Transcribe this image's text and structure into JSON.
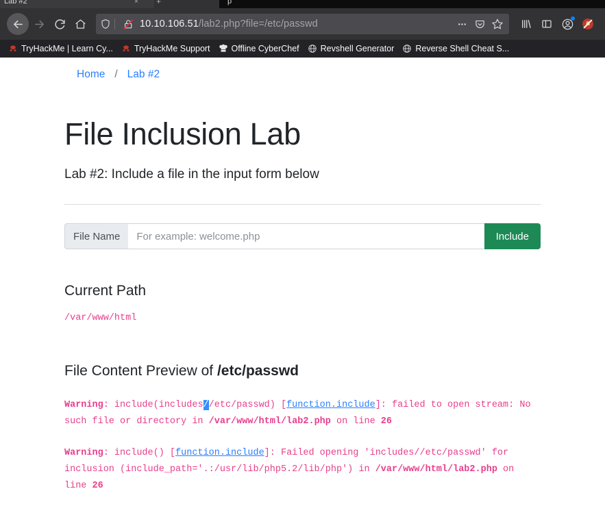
{
  "browser": {
    "tab": {
      "title": "Lab #2",
      "close_label": "×",
      "new_tab_label": "+",
      "spill_title": "p"
    },
    "nav": {
      "back_icon": "back-arrow-icon",
      "forward_icon": "forward-arrow-icon",
      "reload_icon": "reload-icon",
      "home_icon": "home-icon"
    },
    "urlbar": {
      "shield_icon": "tracking-protection-shield-icon",
      "insecure_icon": "insecure-crossed-padlock-icon",
      "url_host": "10.10.106.51",
      "url_path": "/lab2.php?file=/etc/passwd",
      "page_actions_icon": "ellipsis-icon",
      "pocket_icon": "pocket-icon",
      "bookmark_star_icon": "star-icon"
    },
    "toolbar_end": {
      "library_icon": "library-icon",
      "sidebar_icon": "sidebar-icon",
      "account_icon": "account-avatar-icon",
      "extension_icon": "blocked-extension-icon"
    },
    "bookmarks": [
      {
        "label": "TryHackMe | Learn Cy...",
        "icon": "tryhackme-favicon"
      },
      {
        "label": "TryHackMe Support",
        "icon": "tryhackme-favicon"
      },
      {
        "label": "Offline CyberChef",
        "icon": "cyberchef-chefhat-favicon"
      },
      {
        "label": "Revshell Generator",
        "icon": "globe-favicon"
      },
      {
        "label": "Reverse Shell Cheat S...",
        "icon": "globe-favicon"
      }
    ]
  },
  "page": {
    "breadcrumb": {
      "home": "Home",
      "separator": "/",
      "current": "Lab #2"
    },
    "title": "File Inclusion Lab",
    "subtitle": "Lab #2: Include a file in the input form below",
    "form": {
      "label": "File Name",
      "input_value": "",
      "input_placeholder": "For example: welcome.php",
      "submit_label": "Include"
    },
    "current_path": {
      "heading": "Current Path",
      "value": "/var/www/html"
    },
    "preview": {
      "heading_prefix": "File Content Preview of ",
      "heading_file": "/etc/passwd"
    },
    "errors": [
      {
        "label": "Warning",
        "seg1": ": include(includes",
        "selected": "/",
        "seg2": "/etc/passwd) [",
        "link": "function.include",
        "seg3": "]: failed to open stream: No such file or directory in ",
        "file": "/var/www/html/lab2.php",
        "seg4": " on line ",
        "line": "26"
      },
      {
        "label": "Warning",
        "seg1": ": include() [",
        "link": "function.include",
        "seg2": "]: Failed opening 'includes//etc/passwd' for inclusion (include_path='.:/usr/lib/php5.2/lib/php') in ",
        "file": "/var/www/html/lab2.php",
        "seg3": " on line ",
        "line": "26"
      }
    ]
  },
  "colors": {
    "chrome_bg": "#323234",
    "bookmarks_bg": "#232327",
    "urlbar_bg": "#4a4a4f",
    "accent_green": "#1d8a56",
    "link_blue": "#2a7fff",
    "php_pink": "#e83e8c",
    "selection_blue": "#338fff"
  }
}
